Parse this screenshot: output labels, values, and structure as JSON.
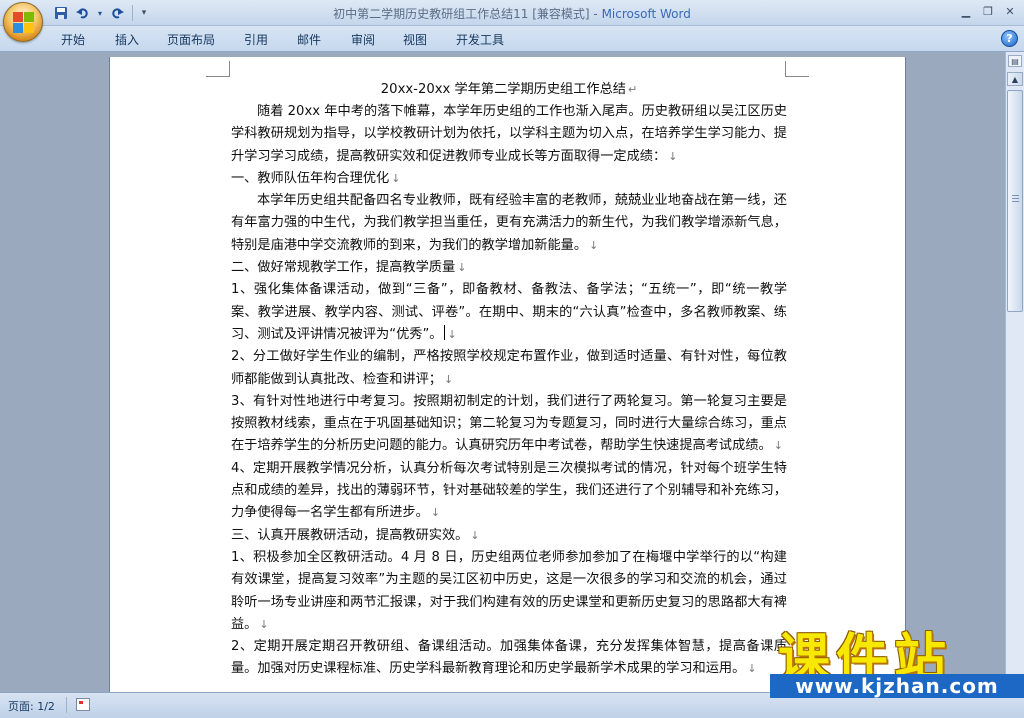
{
  "window": {
    "title_doc": "初中第二学期历史教研组工作总结11 [兼容模式] - ",
    "title_app": "Microsoft Word"
  },
  "quick_access": {
    "save_icon": "save-icon",
    "undo_icon": "undo-icon",
    "redo_icon": "redo-icon",
    "customize_icon": "customize-icon"
  },
  "tabs": [
    "开始",
    "插入",
    "页面布局",
    "引用",
    "邮件",
    "审阅",
    "视图",
    "开发工具"
  ],
  "document": {
    "title": "20xx-20xx 学年第二学期历史组工作总结",
    "paragraphs": [
      {
        "text": "随着 20xx 年中考的落下帷幕，本学年历史组的工作也渐入尾声。历史教研组以吴江区历史学科教研规划为指导，以学校教研计划为依托，以学科主题为切入点，在培养学生学习能力、提升学习学习成绩，提高教研实效和促进教师专业成长等方面取得一定成绩：",
        "indent": true
      },
      {
        "text": "一、教师队伍年构合理优化",
        "indent": false
      },
      {
        "text": "本学年历史组共配备四名专业教师，既有经验丰富的老教师，兢兢业业地奋战在第一线，还有年富力强的中生代，为我们教学担当重任，更有充满活力的新生代，为我们教学增添新气息，特别是庙港中学交流教师的到来，为我们的教学增加新能量。",
        "indent": true
      },
      {
        "text": "二、做好常规教学工作，提高教学质量",
        "indent": false
      },
      {
        "text": "1、强化集体备课活动，做到“三备”，即备教材、备教法、备学法；“五统一”，即“统一教学案、教学进展、教学内容、测试、评卷”。在期中、期末的“六认真”检查中，多名教师教案、练习、测试及评讲情况被评为“优秀”。",
        "indent": false,
        "caret": true
      },
      {
        "text": "2、分工做好学生作业的编制，严格按照学校规定布置作业，做到适时适量、有针对性，每位教师都能做到认真批改、检查和讲评；",
        "indent": false
      },
      {
        "text": "3、有针对性地进行中考复习。按照期初制定的计划，我们进行了两轮复习。第一轮复习主要是按照教材线索，重点在于巩固基础知识；第二轮复习为专题复习，同时进行大量综合练习，重点在于培养学生的分析历史问题的能力。认真研究历年中考试卷，帮助学生快速提高考试成绩。",
        "indent": false
      },
      {
        "text": "4、定期开展教学情况分析，认真分析每次考试特别是三次模拟考试的情况，针对每个班学生特点和成绩的差异，找出的薄弱环节，针对基础较差的学生，我们还进行了个别辅导和补充练习，力争使得每一名学生都有所进步。",
        "indent": false
      },
      {
        "text": "三、认真开展教研活动，提高教研实效。",
        "indent": false
      },
      {
        "text": "1、积极参加全区教研活动。4 月 8 日，历史组两位老师参加参加了在梅堰中学举行的以“构建有效课堂，提高复习效率”为主题的吴江区初中历史，这是一次很多的学习和交流的机会，通过聆听一场专业讲座和两节汇报课，对于我们构建有效的历史课堂和更新历史复习的思路都大有裨益。",
        "indent": false
      },
      {
        "text": "2、定期开展定期召开教研组、备课组活动。加强集体备课，充分发挥集体智慧，提高备课质量。加强对历史课程标准、历史学科最新教育理论和历史学最新学术成果的学习和运用。",
        "indent": false
      }
    ]
  },
  "status": {
    "page_label": "页面: 1/2"
  },
  "watermark": {
    "title": "课件站",
    "url": "www.kjzhan.com"
  },
  "colors": {
    "ribbon": "#c6d8ee",
    "app_accent": "#3a6ab6",
    "doc_background": "#9aa9bd",
    "watermark_yellow": "#f6e800",
    "watermark_blue": "#1d68c4"
  }
}
